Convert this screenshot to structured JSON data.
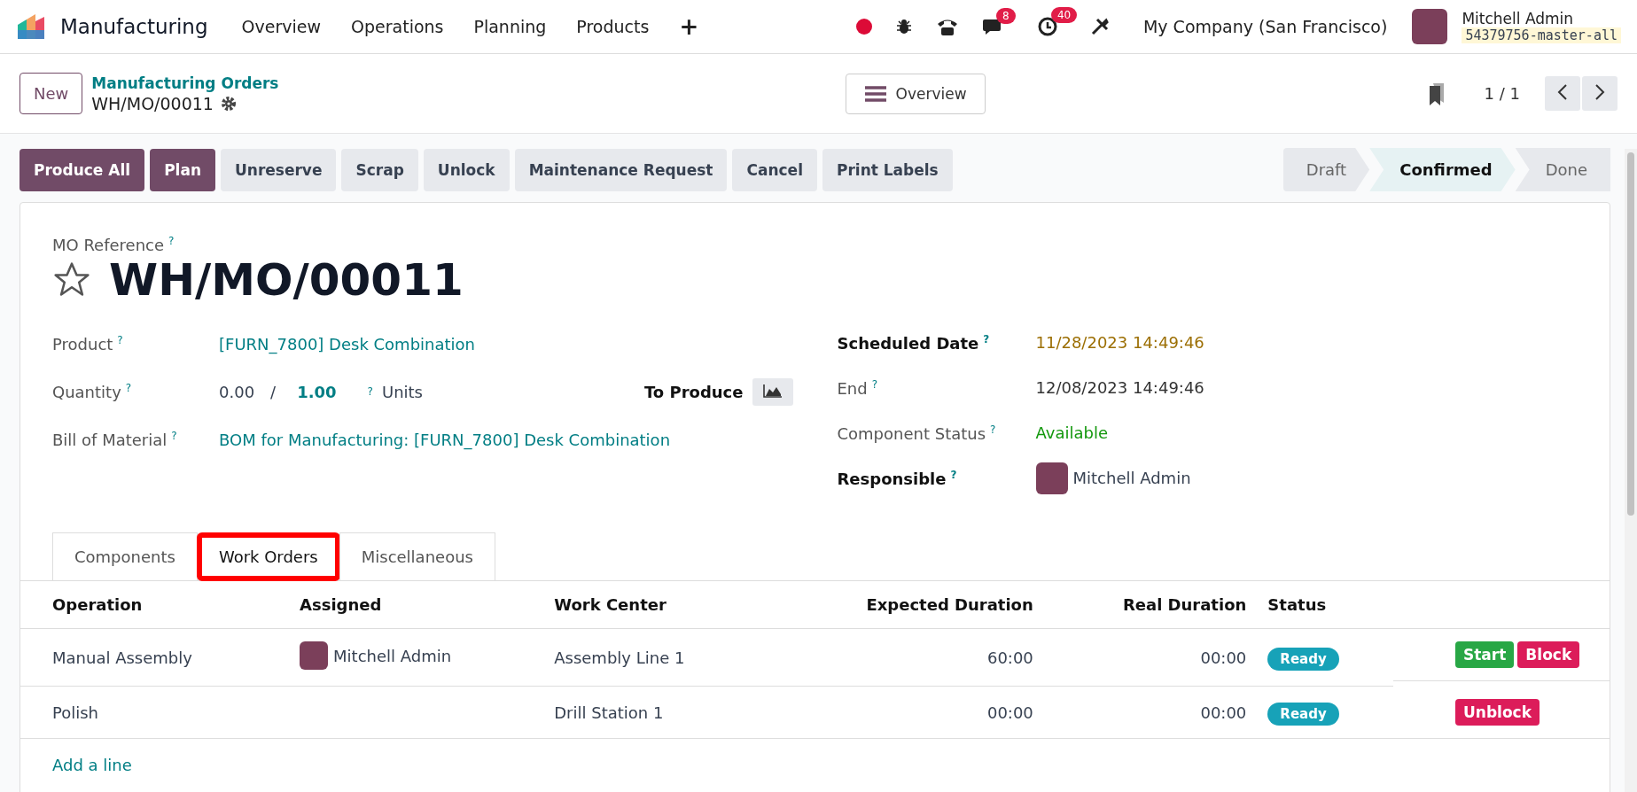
{
  "navbar": {
    "app_name": "Manufacturing",
    "menu": [
      "Overview",
      "Operations",
      "Planning",
      "Products"
    ],
    "add_label": "+",
    "messages_count": "8",
    "activities_count": "40",
    "company": "My Company (San Francisco)",
    "user_name": "Mitchell Admin",
    "database": "54379756-master-all"
  },
  "control_panel": {
    "new_label": "New",
    "breadcrumb": "Manufacturing Orders",
    "record": "WH/MO/00011",
    "overview_label": "Overview",
    "pager": "1 / 1"
  },
  "actions": [
    {
      "label": "Produce All",
      "primary": true
    },
    {
      "label": "Plan",
      "primary": true
    },
    {
      "label": "Unreserve",
      "primary": false
    },
    {
      "label": "Scrap",
      "primary": false
    },
    {
      "label": "Unlock",
      "primary": false
    },
    {
      "label": "Maintenance Request",
      "primary": false
    },
    {
      "label": "Cancel",
      "primary": false
    },
    {
      "label": "Print Labels",
      "primary": false
    }
  ],
  "stages": [
    {
      "label": "Draft",
      "selected": false
    },
    {
      "label": "Confirmed",
      "selected": true
    },
    {
      "label": "Done",
      "selected": false
    }
  ],
  "form": {
    "reference_label": "MO Reference",
    "help": "?",
    "title": "WH/MO/00011",
    "starred": false,
    "left_fields": [
      {
        "kind": "link",
        "label": "Product",
        "value": "[FURN_7800] Desk Combination"
      },
      {
        "kind": "quantity",
        "label": "Quantity",
        "produced": "0.00",
        "separator": "/",
        "target": "1.00",
        "uom": "Units",
        "to_produce_label": "To Produce"
      },
      {
        "kind": "link",
        "label": "Bill of Material",
        "value": "BOM for Manufacturing: [FURN_7800] Desk Combination"
      }
    ],
    "right_fields": [
      {
        "kind": "warning",
        "label": "Scheduled Date",
        "value": "11/28/2023 14:49:46",
        "bold": true
      },
      {
        "kind": "text",
        "label": "End",
        "value": "12/08/2023 14:49:46",
        "bold": false
      },
      {
        "kind": "success",
        "label": "Component Status",
        "value": "Available",
        "bold": false
      },
      {
        "kind": "user",
        "label": "Responsible",
        "value": "Mitchell Admin",
        "bold": true
      }
    ]
  },
  "tabs": [
    {
      "label": "Components",
      "selected": false,
      "highlighted": false
    },
    {
      "label": "Work Orders",
      "selected": true,
      "highlighted": true
    },
    {
      "label": "Miscellaneous",
      "selected": false,
      "highlighted": false
    }
  ],
  "table": {
    "columns": [
      "Operation",
      "Assigned",
      "Work Center",
      "Expected Duration",
      "Real Duration",
      "Status"
    ],
    "rows": [
      {
        "operation": "Manual Assembly",
        "assigned": "Mitchell Admin",
        "work_center": "Assembly Line 1",
        "expected": "60:00",
        "real": "00:00",
        "status": "Ready",
        "buttons": [
          {
            "label": "Start",
            "kind": "success"
          },
          {
            "label": "Block",
            "kind": "danger"
          }
        ]
      },
      {
        "operation": "Polish",
        "work_center": "Drill Station 1",
        "expected": "00:00",
        "real": "00:00",
        "status": "Ready",
        "buttons": [
          {
            "label": "Unblock",
            "kind": "danger"
          }
        ]
      }
    ],
    "add_line": "Add a line"
  }
}
